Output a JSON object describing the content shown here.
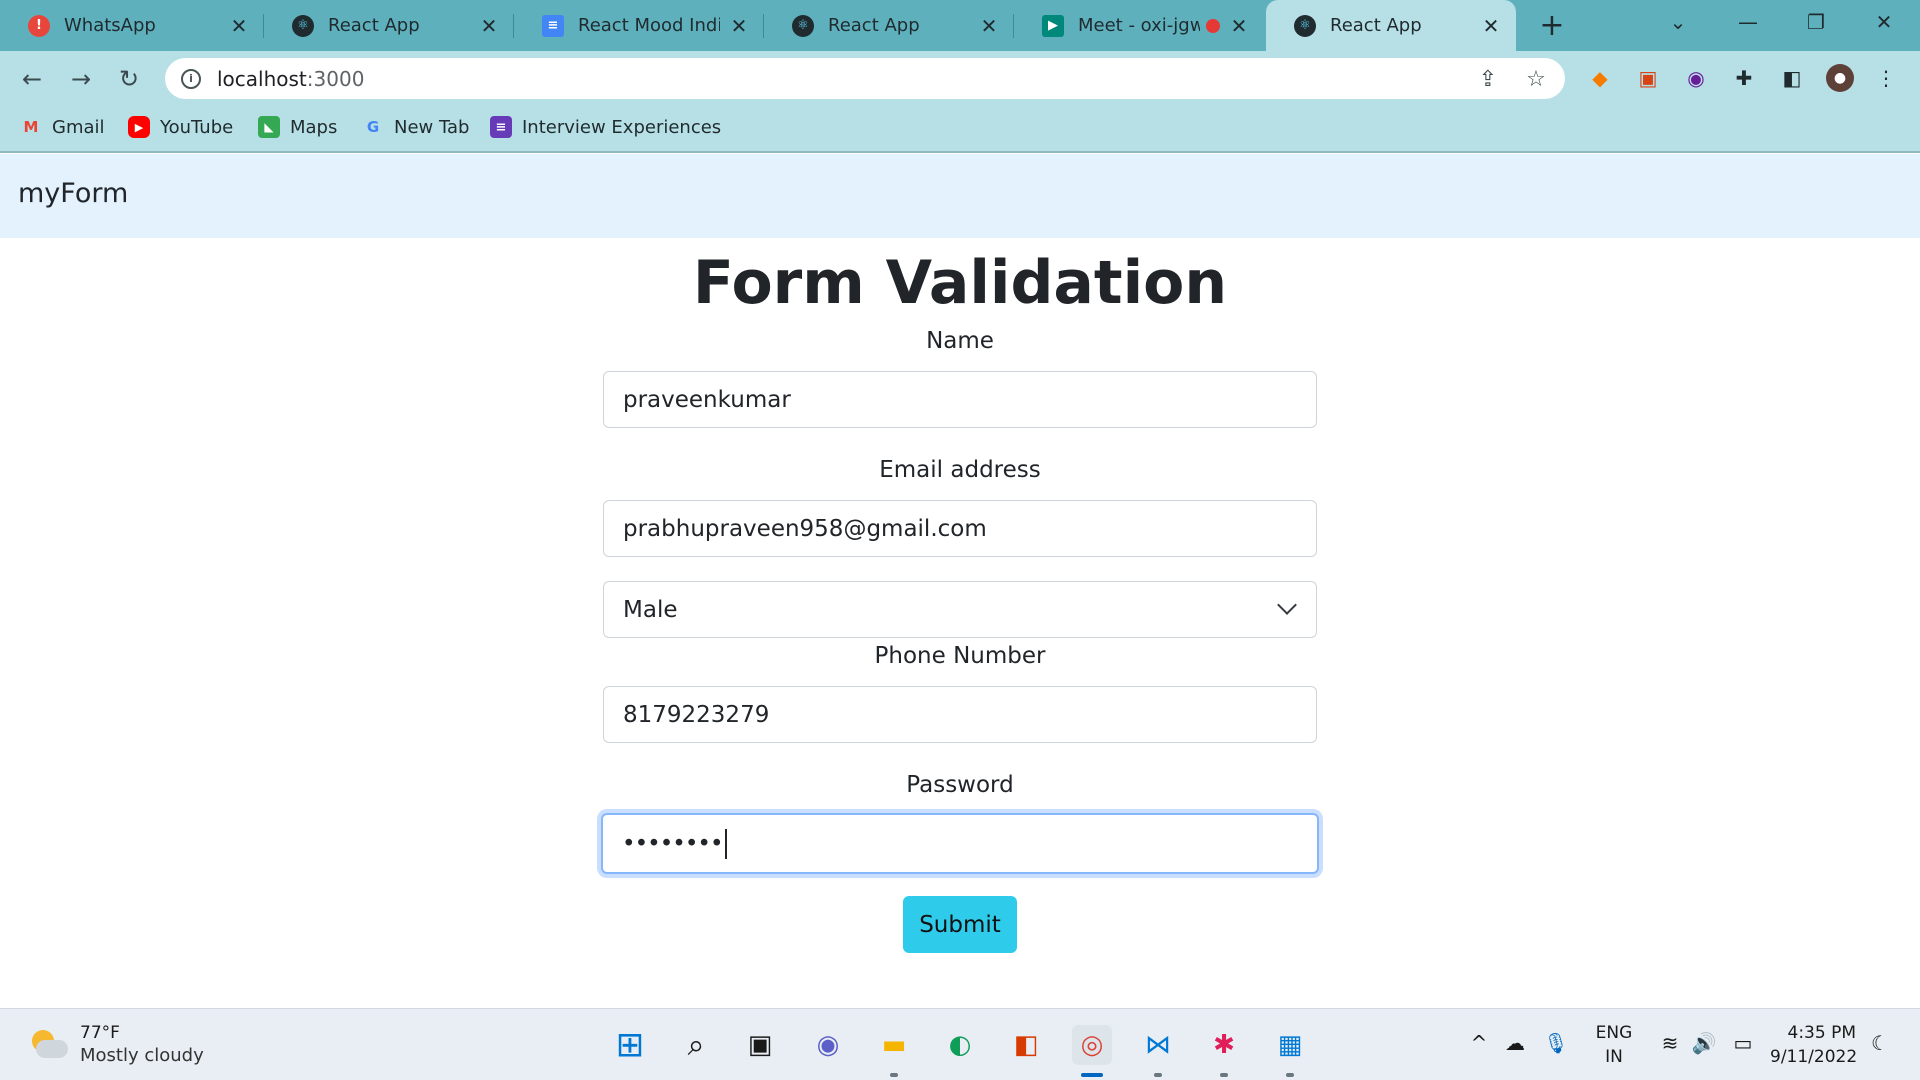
{
  "browser": {
    "tabs": [
      {
        "title": "WhatsApp",
        "icon": "whatsapp-icon",
        "icon_color": "#e8453c",
        "active": false
      },
      {
        "title": "React App",
        "icon": "react-icon",
        "icon_color": "#1f2b2e",
        "active": false
      },
      {
        "title": "React Mood Indicat",
        "icon": "docs-icon",
        "icon_color": "#4285f4",
        "active": false
      },
      {
        "title": "React App",
        "icon": "react-icon",
        "icon_color": "#1f2b2e",
        "active": false
      },
      {
        "title": "Meet - oxi-jgw",
        "icon": "meet-icon",
        "icon_color": "#00897b",
        "active": false,
        "recording": true
      },
      {
        "title": "React App",
        "icon": "react-icon",
        "icon_color": "#1f2b2e",
        "active": true
      }
    ],
    "address": {
      "host": "localhost",
      "port": ":3000"
    },
    "bookmarks": [
      {
        "label": "Gmail",
        "icon": "gmail-icon",
        "color": "#ea4335"
      },
      {
        "label": "YouTube",
        "icon": "youtube-icon",
        "color": "#ff0000"
      },
      {
        "label": "Maps",
        "icon": "maps-icon",
        "color": "#34a853"
      },
      {
        "label": "New Tab",
        "icon": "google-icon",
        "color": "#4285f4"
      },
      {
        "label": "Interview Experiences",
        "icon": "forms-icon",
        "color": "#673ab7"
      }
    ]
  },
  "page": {
    "brand": "myForm",
    "heading": "Form Validation",
    "name_label": "Name",
    "name_value": "praveenkumar",
    "email_label": "Email address",
    "email_value": "prabhupraveen958@gmail.com",
    "gender_value": "Male",
    "phone_label": "Phone Number",
    "phone_value": "8179223279",
    "password_label": "Password",
    "password_masked": "••••••••",
    "submit_label": "Submit"
  },
  "taskbar": {
    "weather_temp": "77°F",
    "weather_desc": "Mostly cloudy",
    "lang_line1": "ENG",
    "lang_line2": "IN",
    "time": "4:35 PM",
    "date": "9/11/2022",
    "accent": "#0067c0"
  }
}
